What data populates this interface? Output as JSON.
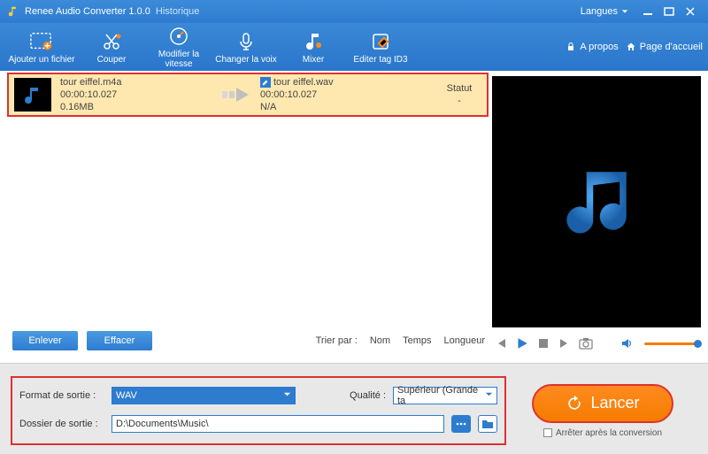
{
  "titlebar": {
    "app": "Renee Audio Converter 1.0.0",
    "history": "Historique",
    "lang": "Langues"
  },
  "toolbar": {
    "add": "Ajouter un fichier",
    "cut": "Couper",
    "speed": "Modifier la vitesse",
    "voice": "Changer la voix",
    "mixer": "Mixer",
    "id3": "Editer tag ID3",
    "about": "A propos",
    "home": "Page d'accueil"
  },
  "file": {
    "src_name": "tour eiffel.m4a",
    "src_dur": "00:00:10.027",
    "src_size": "0.16MB",
    "dst_name": "tour eiffel.wav",
    "dst_dur": "00:00:10.027",
    "dst_size": "N/A",
    "status_label": "Statut",
    "status_value": "-"
  },
  "buttons": {
    "remove": "Enlever",
    "clear": "Effacer"
  },
  "sort": {
    "label": "Trier par :",
    "name": "Nom",
    "time": "Temps",
    "length": "Longueur"
  },
  "settings": {
    "format_label": "Format de sortie :",
    "format_value": "WAV",
    "quality_label": "Qualité :",
    "quality_value": "Supérieur (Grande ta",
    "folder_label": "Dossier de sortie :",
    "folder_value": "D:\\Documents\\Music\\"
  },
  "launch": {
    "label": "Lancer",
    "stop_after": "Arrêter après la conversion"
  }
}
